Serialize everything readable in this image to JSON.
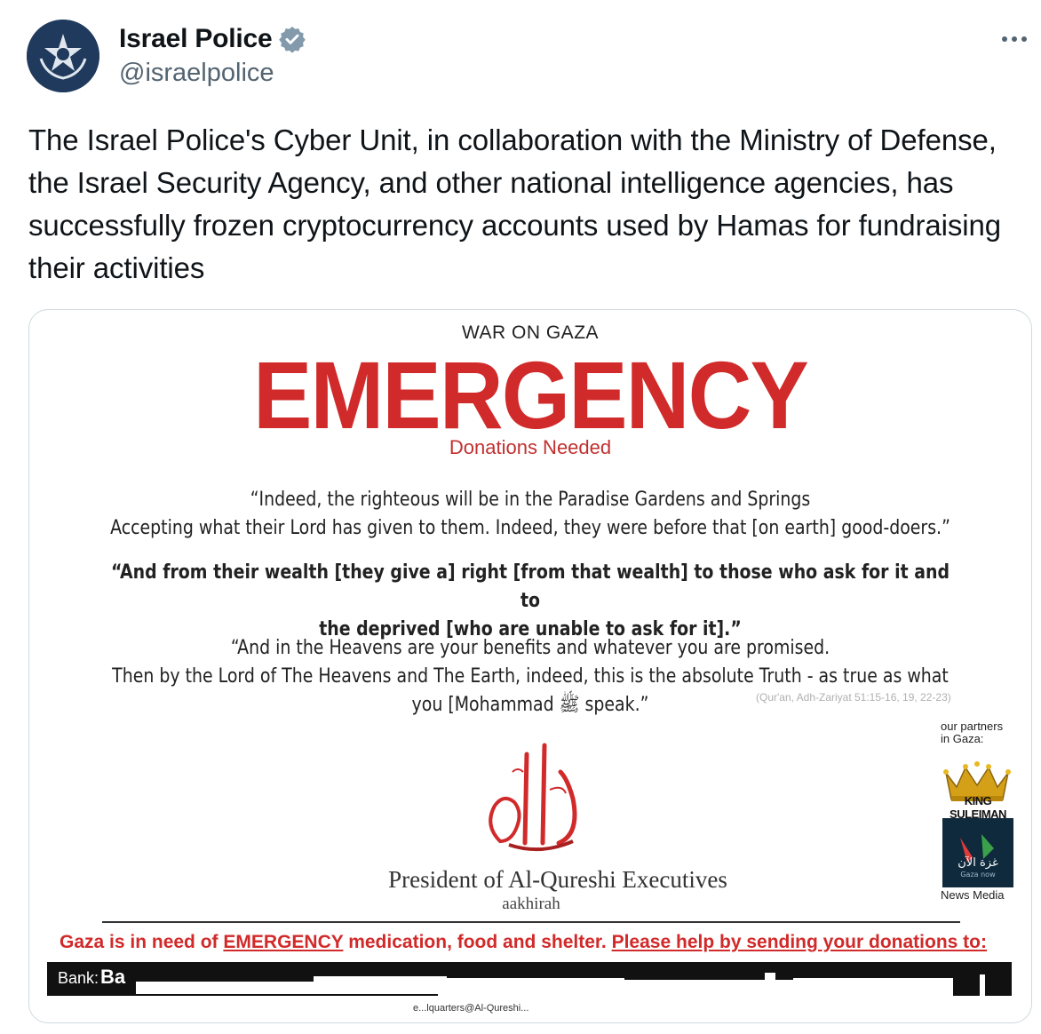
{
  "user": {
    "display_name": "Israel Police",
    "handle": "@israelpolice",
    "verified": true
  },
  "tweet": {
    "text": "The Israel Police's Cyber Unit, in collaboration with the Ministry of Defense, the Israel Security Agency, and other national intelligence agencies, has successfully frozen cryptocurrency accounts used by Hamas for fundraising their activities"
  },
  "poster": {
    "war_label": "WAR ON GAZA",
    "headline": "EMERGENCY",
    "subheadline": "Donations Needed",
    "quote1_line1": "“Indeed, the righteous will be in the Paradise Gardens and Springs",
    "quote1_line2": "Accepting what their Lord has given to them. Indeed, they were before that [on earth] good-doers.”",
    "quote2_line1": "“And from their wealth [they give a] right [from that wealth] to those who ask for it and to",
    "quote2_line2": "the deprived [who are unable to ask for it].”",
    "quote3_line1": "“And in the Heavens are your benefits and whatever you are promised.",
    "quote3_line2": "Then by the Lord of The Heavens and The Earth, indeed, this is the absolute Truth - as true as what",
    "quote3_line3": "you [Mohammad ﷺ speak.”",
    "reference": "(Qur'an, Adh-Zariyat 51:15-16, 19, 22-23)",
    "partners_label_1": "our partners",
    "partners_label_2": "in Gaza:",
    "partner1": "KING SULEIMAN",
    "partner2_arabic": "غزة الآن",
    "partner2_sub": "Gaza now",
    "partner2_label": "News Media",
    "president": "President of Al-Qureshi Executives",
    "aakhirah": "aakhirah",
    "appeal_prefix": "Gaza is in need of ",
    "appeal_emergency": "EMERGENCY",
    "appeal_middle": " medication, food and shelter. ",
    "appeal_help": "Please help by sending your donations to:",
    "bank_label": "Bank:",
    "bank_value": "Ba",
    "footer": "e...lquarters@Al-Qureshi..."
  },
  "colors": {
    "accent_red": "#d12a2a",
    "verified_badge": "#829aab",
    "handle_gray": "#536471"
  },
  "icons": {
    "verified": "verified-badge-icon",
    "more": "more-options-icon"
  }
}
